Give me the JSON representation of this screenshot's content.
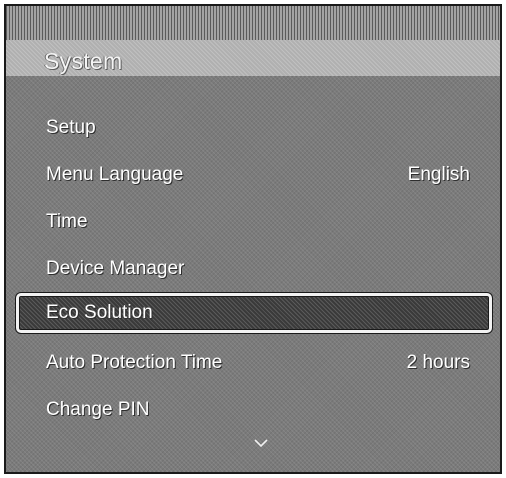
{
  "menu": {
    "title": "System",
    "items": [
      {
        "label": "Setup",
        "value": ""
      },
      {
        "label": "Menu Language",
        "value": "English"
      },
      {
        "label": "Time",
        "value": ""
      },
      {
        "label": "Device Manager",
        "value": ""
      },
      {
        "label": "Eco Solution",
        "value": "",
        "selected": true
      },
      {
        "label": "Auto Protection Time",
        "value": "2 hours"
      },
      {
        "label": "Change PIN",
        "value": ""
      }
    ],
    "more_indicator_icon": "chevron-down-icon"
  }
}
